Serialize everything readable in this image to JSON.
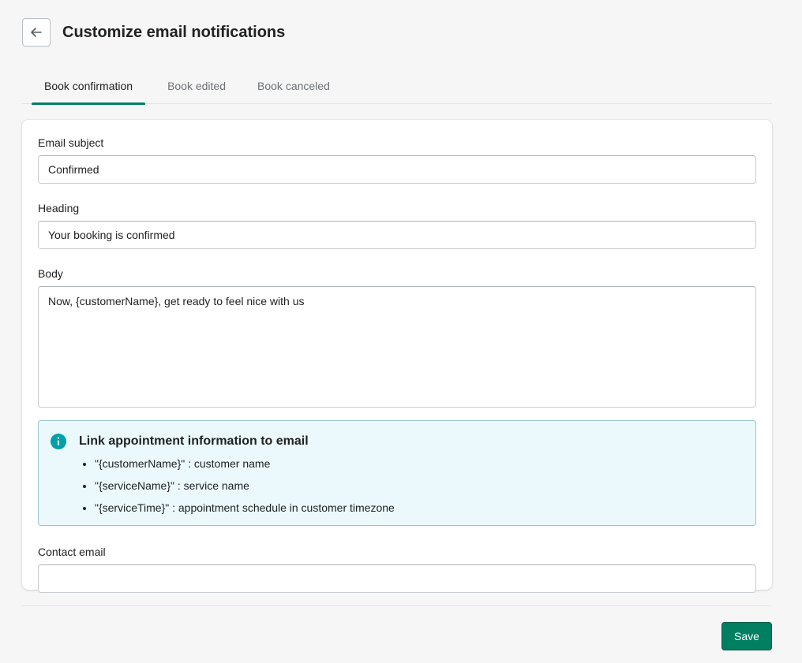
{
  "header": {
    "title": "Customize email notifications"
  },
  "tabs": [
    {
      "label": "Book confirmation",
      "active": true
    },
    {
      "label": "Book edited",
      "active": false
    },
    {
      "label": "Book canceled",
      "active": false
    }
  ],
  "form": {
    "subject_label": "Email subject",
    "subject_value": "Confirmed",
    "heading_label": "Heading",
    "heading_value": "Your booking is confirmed",
    "body_label": "Body",
    "body_value": "Now, {customerName}, get ready to feel nice with us",
    "contact_label": "Contact email",
    "contact_value": ""
  },
  "banner": {
    "title": "Link appointment information to email",
    "items": [
      "\"{customerName}\" : customer name",
      "\"{serviceName}\" : service name",
      "\"{serviceTime}\" : appointment schedule in customer timezone"
    ]
  },
  "footer": {
    "save_label": "Save"
  },
  "colors": {
    "accent": "#008060",
    "info_bg": "#ebf9fc",
    "info_icon": "#00a0ac"
  },
  "icons": {
    "back": "arrow-left-icon",
    "info": "info-icon"
  }
}
